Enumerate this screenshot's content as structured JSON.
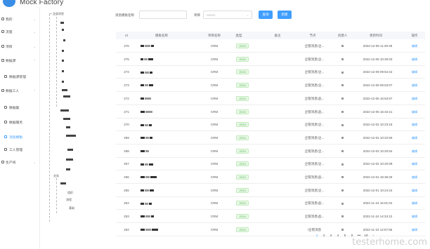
{
  "app": {
    "title": "Mock Factory"
  },
  "sidebar": {
    "items": [
      {
        "label": "我的",
        "icon": "user-icon",
        "expandable": true
      },
      {
        "label": "流量",
        "icon": "flow-icon",
        "expandable": true
      },
      {
        "label": "项目",
        "icon": "project-icon",
        "expandable": true
      },
      {
        "label": "数据源",
        "icon": "database-icon",
        "expandable": true
      },
      {
        "label": "数据源管理",
        "icon": "folder-icon",
        "expandable": false,
        "sub": true
      },
      {
        "label": "数据工人",
        "icon": "worker-icon",
        "expandable": true
      },
      {
        "label": "数据集",
        "icon": "dataset-icon",
        "expandable": false,
        "sub": true
      },
      {
        "label": "数据服务",
        "icon": "service-icon",
        "expandable": false,
        "sub": true
      },
      {
        "label": "消息模板",
        "icon": "template-icon",
        "expandable": false,
        "sub": true,
        "active": true
      },
      {
        "label": "工人管理",
        "icon": "manage-icon",
        "expandable": false,
        "sub": true
      },
      {
        "label": "生产线",
        "icon": "pipeline-icon",
        "expandable": true
      }
    ]
  },
  "tree": {
    "root": "全部消息",
    "nodes": [
      "业务",
      "组织",
      "流程",
      "基础"
    ]
  },
  "filter": {
    "name_label": "消息模板名称",
    "name_placeholder": "",
    "project_label": "项目",
    "project_placeholder": "Select",
    "search_button": "查询",
    "new_button": "新建"
  },
  "table": {
    "headers": [
      "Id",
      "模板名称",
      "项目名称",
      "类型",
      "备注",
      "节点",
      "创建人",
      "更新时间",
      "操作"
    ],
    "rows": [
      {
        "id": "276",
        "project": "CRM",
        "type": "JSON",
        "node": "企管消息/企...",
        "time": "2022-12-09 11:30:49",
        "action": "编辑"
      },
      {
        "id": "275",
        "project": "CRM",
        "type": "JSON",
        "node": "企管消息/企...",
        "time": "2022-12-09 10:30:03",
        "action": "编辑"
      },
      {
        "id": "274",
        "project": "CRM",
        "type": "JSON",
        "node": "企管消息/企...",
        "time": "2022-12-09 09:54:42",
        "action": "编辑"
      },
      {
        "id": "273",
        "project": "CRM",
        "type": "JSON",
        "node": "企管消息/企...",
        "time": "2022-12-09 09:53:07",
        "action": "编辑"
      },
      {
        "id": "272",
        "project": "CRM",
        "type": "JSON",
        "node": "企管消息/品...",
        "time": "2022-12-05 16:53:57",
        "action": "编辑"
      },
      {
        "id": "271",
        "project": "CRM",
        "type": "JSON",
        "node": "企管消息/品...",
        "time": "2022-12-05 16:32:21",
        "action": "编辑"
      },
      {
        "id": "270",
        "project": "CRM",
        "type": "JSON",
        "node": "企管消息/企...",
        "time": "2022-12-02 10:23:18",
        "action": "编辑"
      },
      {
        "id": "259",
        "project": "CRM",
        "type": "JSON",
        "node": "企管消息/企...",
        "time": "2022-12-02 10:22:59",
        "action": "编辑"
      },
      {
        "id": "258",
        "project": "CRM",
        "type": "JSON",
        "node": "企管消息/企...",
        "time": "2022-12-02 10:20:54",
        "action": "编辑"
      },
      {
        "id": "257",
        "project": "CRM",
        "type": "JSON",
        "node": "企管消息/企...",
        "time": "2022-12-02 10:20:08",
        "action": "编辑"
      },
      {
        "id": "256",
        "project": "CRM",
        "type": "JSON",
        "node": "企管消息/品...",
        "time": "2022-12-01 16:36:26",
        "action": "编辑"
      },
      {
        "id": "255",
        "project": "CRM",
        "type": "JSON",
        "node": "企管消息/企...",
        "time": "2022-12-01 10:24:34",
        "action": "编辑"
      },
      {
        "id": "254",
        "project": "CRM",
        "type": "JSON",
        "node": "企管消息/品...",
        "time": "2022-11-24 16:01:04",
        "action": "编辑"
      },
      {
        "id": "253",
        "project": "CRM",
        "type": "JSON",
        "node": "企管消息/品...",
        "time": "2022-11-24 14:34:13",
        "action": "编辑"
      },
      {
        "id": "252",
        "project": "CRM",
        "type": "JSON",
        "node": "/企管消息",
        "time": "2022-11-24 12:57:56",
        "action": "编辑"
      }
    ]
  },
  "pagination": {
    "pages": [
      "1",
      "2",
      "3",
      "4",
      "5",
      "6",
      "•••",
      "19"
    ],
    "active": "1",
    "next": "›"
  },
  "watermark": "testerhome.com"
}
